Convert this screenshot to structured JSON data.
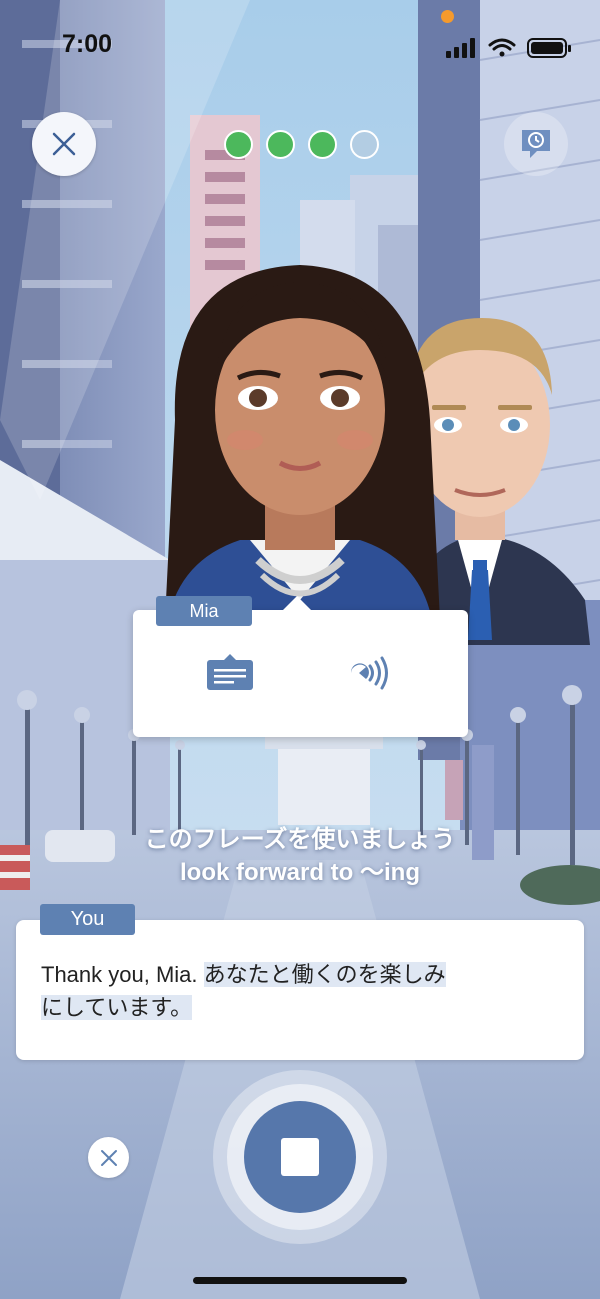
{
  "status_bar": {
    "time": "7:00"
  },
  "top_bar": {
    "close_icon": "close-icon",
    "hint_icon": "chat-clock-icon"
  },
  "progress": {
    "total": 4,
    "completed": 3
  },
  "speaker_popup": {
    "speaker_name": "Mia",
    "transcript_icon": "transcript-icon",
    "audio_icon": "speaker-audio-icon"
  },
  "phrase_hint": {
    "instruction": "このフレーズを使いましょう",
    "phrase": "look forward to ～ing"
  },
  "reply": {
    "speaker_tag": "You",
    "text_plain": "Thank you, Mia. ",
    "text_line1_highlight": "あなたと働くのを楽しみ",
    "text_line2_highlight": "にしています。"
  },
  "controls": {
    "cancel_icon": "close-icon",
    "stop_icon": "stop-icon"
  },
  "colors": {
    "accent": "#5e81b2",
    "progress_done": "#4cb85c",
    "progress_todo": "#b3cde3",
    "highlight": "#dfe7f3"
  }
}
